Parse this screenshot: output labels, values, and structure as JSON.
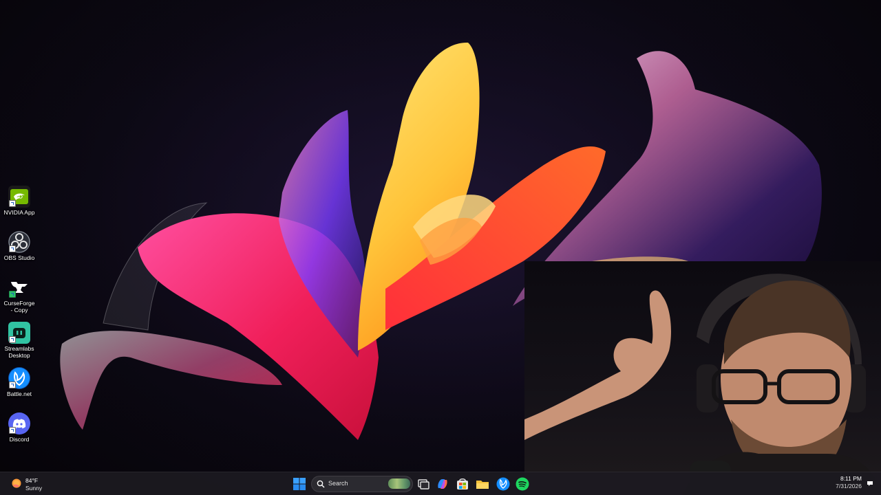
{
  "desktop": {
    "icons": [
      {
        "name": "nvidia-app",
        "label": "NVIDIA App",
        "icon": "nvidia-icon",
        "color": "#76b900"
      },
      {
        "name": "obs-studio",
        "label": "OBS Studio",
        "icon": "obs-icon",
        "color": "#2b2e38"
      },
      {
        "name": "curseforge",
        "label": "CurseForge - Copy",
        "icon": "curseforge-icon",
        "color": "#f16436"
      },
      {
        "name": "streamlabs",
        "label": "Streamlabs Desktop",
        "icon": "streamlabs-icon",
        "color": "#31c3a2"
      },
      {
        "name": "battlenet",
        "label": "Battle.net",
        "icon": "battlenet-icon",
        "color": "#148eff"
      },
      {
        "name": "discord",
        "label": "Discord",
        "icon": "discord-icon",
        "color": "#5865f2"
      }
    ]
  },
  "taskbar": {
    "weather": {
      "temp": "84°F",
      "condition": "Sunny",
      "icon": "sun-icon"
    },
    "start_icon": "windows-start-icon",
    "search": {
      "placeholder": "Search"
    },
    "apps": [
      {
        "name": "task-view",
        "icon": "task-view-icon"
      },
      {
        "name": "copilot",
        "icon": "copilot-icon"
      },
      {
        "name": "microsoft-store",
        "icon": "store-icon"
      },
      {
        "name": "file-explorer",
        "icon": "folder-icon"
      },
      {
        "name": "battlenet",
        "icon": "battlenet-icon"
      },
      {
        "name": "spotify",
        "icon": "spotify-icon"
      }
    ],
    "clock": {
      "time": "8:11 PM",
      "date": "7/31/2026"
    },
    "notification_icon": "notification-bell-icon"
  },
  "colors": {
    "taskbar_bg": "#1c1a20",
    "accent_blue": "#0078d4"
  }
}
